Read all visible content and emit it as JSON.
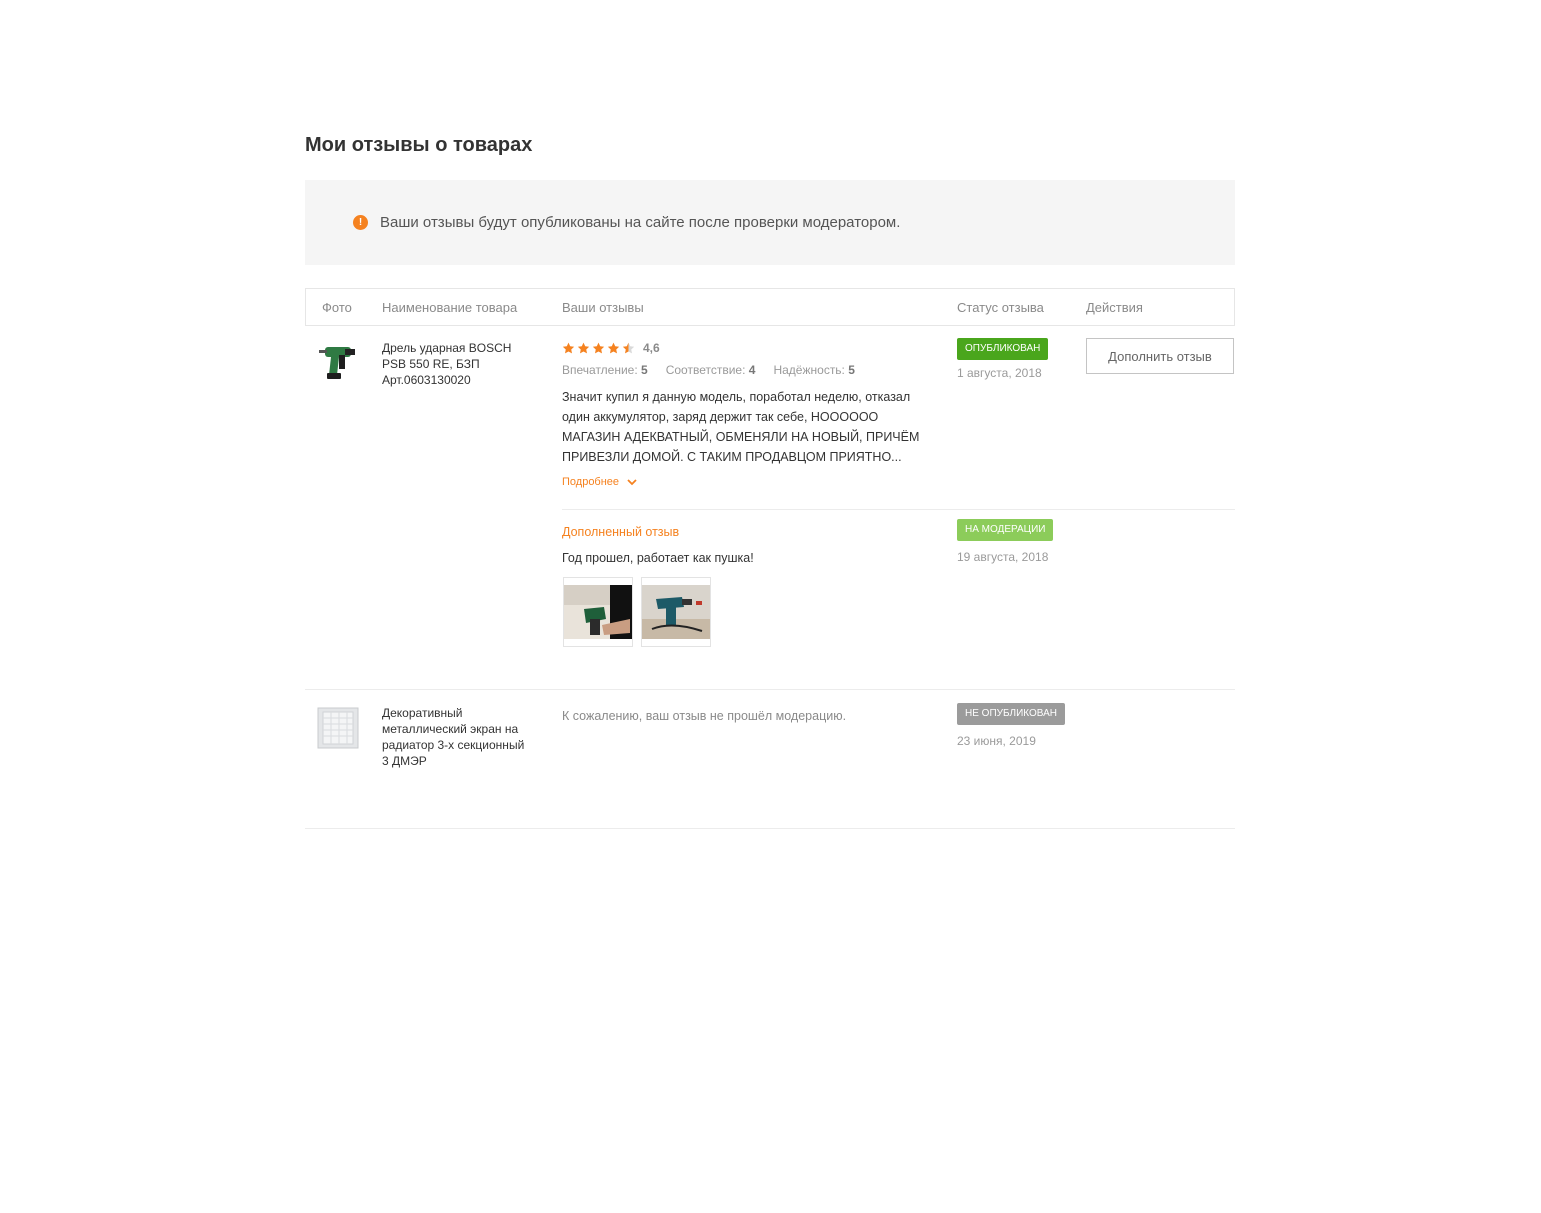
{
  "page": {
    "title": "Мои отзывы о товарах"
  },
  "notice": {
    "icon": "exclamation-icon",
    "icon_glyph": "!",
    "text": "Ваши отзывы будут опубликованы на сайте после проверки модератором."
  },
  "table": {
    "headers": {
      "photo": "Фото",
      "name": "Наименование товара",
      "reviews": "Ваши отзывы",
      "status": "Статус отзыва",
      "actions": "Действия"
    }
  },
  "items": [
    {
      "product": {
        "name_lines": [
          "Дрель ударная BOSCH",
          "PSB 550 RE, БЗП",
          "Арт.0603130020"
        ],
        "image_icon": "drill-icon"
      },
      "review": {
        "stars": 4.5,
        "rating_text": "4,6",
        "criteria": [
          {
            "label": "Впечатление:",
            "value": "5"
          },
          {
            "label": "Соответствие:",
            "value": "4"
          },
          {
            "label": "Надёжность:",
            "value": "5"
          }
        ],
        "text": "Значит купил я данную модель, поработал неделю, отказал один аккумулятор, заряд держит так себе, НОООООО МАГАЗИН АДЕКВАТНЫЙ, ОБМЕНЯЛИ НА НОВЫЙ, ПРИЧЁМ ПРИВЕЗЛИ ДОМОЙ. С ТАКИМ ПРОДАВЦОМ ПРИЯТНО...",
        "more_label": "Подробнее"
      },
      "status": {
        "label": "ОПУБЛИКОВАН",
        "color": "#4aa61c",
        "date": "1 августа, 2018"
      },
      "action_label": "Дополнить отзыв",
      "addition": {
        "title": "Дополненный отзыв",
        "text": "Год прошел, работает как пушка!",
        "photos": [
          "drill-photo-1",
          "drill-photo-2"
        ],
        "status": {
          "label": "НА МОДЕРАЦИИ",
          "color": "#8ccc5a",
          "date": "19 августа, 2018"
        }
      }
    },
    {
      "product": {
        "name_lines": [
          "Декоративный",
          "металлический экран на",
          "радиатор 3-х секционный",
          "3 ДМЭР"
        ],
        "image_icon": "radiator-screen-icon"
      },
      "review": {
        "text": "К сожалению, ваш отзыв не прошёл модерацию."
      },
      "status": {
        "label": "НЕ ОПУБЛИКОВАН",
        "color": "#9b9b9b",
        "date": "23 июня, 2019"
      }
    }
  ],
  "colors": {
    "accent": "#f58220",
    "star": "#f58220"
  }
}
